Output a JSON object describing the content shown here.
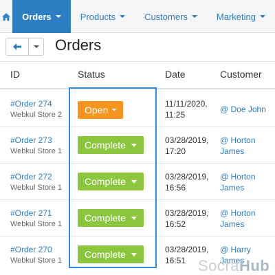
{
  "nav": {
    "home_icon": "home-icon",
    "tabs": [
      {
        "label": "Orders",
        "active": true
      },
      {
        "label": "Products",
        "active": false
      },
      {
        "label": "Customers",
        "active": false
      },
      {
        "label": "Marketing",
        "active": false
      }
    ]
  },
  "toolbar": {
    "back_icon": "arrow-left-icon",
    "dropdown_icon": "chevron-down-icon",
    "title": "Orders"
  },
  "table": {
    "headers": {
      "id": "ID",
      "status": "Status",
      "date": "Date",
      "customer": "Customer"
    },
    "rows": [
      {
        "order": "#Order 274",
        "store": "Webkul Store 2",
        "status": "Open",
        "status_type": "open",
        "date_line1": "11/11/2020,",
        "date_line2": "11:25",
        "customer_line1": "@ Doe John",
        "customer_line2": ""
      },
      {
        "order": "#Order 273",
        "store": "Webkul Store 1",
        "status": "Complete",
        "status_type": "complete",
        "date_line1": "03/28/2019,",
        "date_line2": "17:20",
        "customer_line1": "@ Horton",
        "customer_line2": "James"
      },
      {
        "order": "#Order 272",
        "store": "Webkul Store 1",
        "status": "Complete",
        "status_type": "complete",
        "date_line1": "03/28/2019,",
        "date_line2": "16:56",
        "customer_line1": "@ Horton",
        "customer_line2": "James"
      },
      {
        "order": "#Order 271",
        "store": "Webkul Store 1",
        "status": "Complete",
        "status_type": "complete",
        "date_line1": "03/28/2019,",
        "date_line2": "16:52",
        "customer_line1": "@ Horton",
        "customer_line2": "James"
      },
      {
        "order": "#Order 270",
        "store": "Webkul Store 1",
        "status": "Complete",
        "status_type": "complete",
        "date_line1": "03/28/2019,",
        "date_line2": "16:51",
        "customer_line1": "@ Harry",
        "customer_line2": "James"
      }
    ]
  },
  "watermark": {
    "part1": "Socra",
    "part2": "Hub"
  },
  "colors": {
    "nav_active": "#2d7fc3",
    "link": "#2c7cc0",
    "status_open": "#f7931e",
    "status_complete": "#8cc63e",
    "highlight_border": "#2f8be8"
  }
}
